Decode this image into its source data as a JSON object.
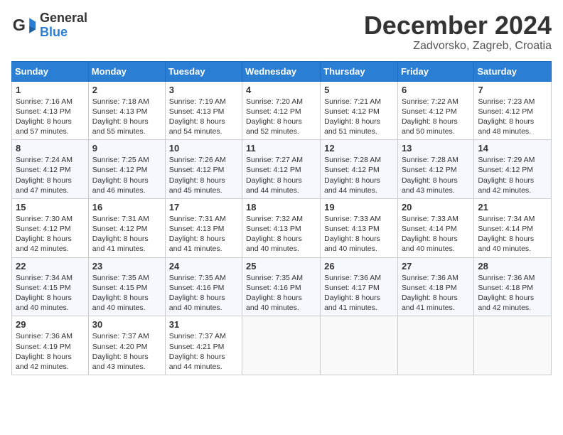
{
  "logo": {
    "general": "General",
    "blue": "Blue"
  },
  "title": "December 2024",
  "location": "Zadvorsko, Zagreb, Croatia",
  "columns": [
    "Sunday",
    "Monday",
    "Tuesday",
    "Wednesday",
    "Thursday",
    "Friday",
    "Saturday"
  ],
  "weeks": [
    [
      {
        "day": "1",
        "sunrise": "7:16 AM",
        "sunset": "4:13 PM",
        "daylight": "8 hours and 57 minutes."
      },
      {
        "day": "2",
        "sunrise": "7:18 AM",
        "sunset": "4:13 PM",
        "daylight": "8 hours and 55 minutes."
      },
      {
        "day": "3",
        "sunrise": "7:19 AM",
        "sunset": "4:13 PM",
        "daylight": "8 hours and 54 minutes."
      },
      {
        "day": "4",
        "sunrise": "7:20 AM",
        "sunset": "4:12 PM",
        "daylight": "8 hours and 52 minutes."
      },
      {
        "day": "5",
        "sunrise": "7:21 AM",
        "sunset": "4:12 PM",
        "daylight": "8 hours and 51 minutes."
      },
      {
        "day": "6",
        "sunrise": "7:22 AM",
        "sunset": "4:12 PM",
        "daylight": "8 hours and 50 minutes."
      },
      {
        "day": "7",
        "sunrise": "7:23 AM",
        "sunset": "4:12 PM",
        "daylight": "8 hours and 48 minutes."
      }
    ],
    [
      {
        "day": "8",
        "sunrise": "7:24 AM",
        "sunset": "4:12 PM",
        "daylight": "8 hours and 47 minutes."
      },
      {
        "day": "9",
        "sunrise": "7:25 AM",
        "sunset": "4:12 PM",
        "daylight": "8 hours and 46 minutes."
      },
      {
        "day": "10",
        "sunrise": "7:26 AM",
        "sunset": "4:12 PM",
        "daylight": "8 hours and 45 minutes."
      },
      {
        "day": "11",
        "sunrise": "7:27 AM",
        "sunset": "4:12 PM",
        "daylight": "8 hours and 44 minutes."
      },
      {
        "day": "12",
        "sunrise": "7:28 AM",
        "sunset": "4:12 PM",
        "daylight": "8 hours and 44 minutes."
      },
      {
        "day": "13",
        "sunrise": "7:28 AM",
        "sunset": "4:12 PM",
        "daylight": "8 hours and 43 minutes."
      },
      {
        "day": "14",
        "sunrise": "7:29 AM",
        "sunset": "4:12 PM",
        "daylight": "8 hours and 42 minutes."
      }
    ],
    [
      {
        "day": "15",
        "sunrise": "7:30 AM",
        "sunset": "4:12 PM",
        "daylight": "8 hours and 42 minutes."
      },
      {
        "day": "16",
        "sunrise": "7:31 AM",
        "sunset": "4:12 PM",
        "daylight": "8 hours and 41 minutes."
      },
      {
        "day": "17",
        "sunrise": "7:31 AM",
        "sunset": "4:13 PM",
        "daylight": "8 hours and 41 minutes."
      },
      {
        "day": "18",
        "sunrise": "7:32 AM",
        "sunset": "4:13 PM",
        "daylight": "8 hours and 40 minutes."
      },
      {
        "day": "19",
        "sunrise": "7:33 AM",
        "sunset": "4:13 PM",
        "daylight": "8 hours and 40 minutes."
      },
      {
        "day": "20",
        "sunrise": "7:33 AM",
        "sunset": "4:14 PM",
        "daylight": "8 hours and 40 minutes."
      },
      {
        "day": "21",
        "sunrise": "7:34 AM",
        "sunset": "4:14 PM",
        "daylight": "8 hours and 40 minutes."
      }
    ],
    [
      {
        "day": "22",
        "sunrise": "7:34 AM",
        "sunset": "4:15 PM",
        "daylight": "8 hours and 40 minutes."
      },
      {
        "day": "23",
        "sunrise": "7:35 AM",
        "sunset": "4:15 PM",
        "daylight": "8 hours and 40 minutes."
      },
      {
        "day": "24",
        "sunrise": "7:35 AM",
        "sunset": "4:16 PM",
        "daylight": "8 hours and 40 minutes."
      },
      {
        "day": "25",
        "sunrise": "7:35 AM",
        "sunset": "4:16 PM",
        "daylight": "8 hours and 40 minutes."
      },
      {
        "day": "26",
        "sunrise": "7:36 AM",
        "sunset": "4:17 PM",
        "daylight": "8 hours and 41 minutes."
      },
      {
        "day": "27",
        "sunrise": "7:36 AM",
        "sunset": "4:18 PM",
        "daylight": "8 hours and 41 minutes."
      },
      {
        "day": "28",
        "sunrise": "7:36 AM",
        "sunset": "4:18 PM",
        "daylight": "8 hours and 42 minutes."
      }
    ],
    [
      {
        "day": "29",
        "sunrise": "7:36 AM",
        "sunset": "4:19 PM",
        "daylight": "8 hours and 42 minutes."
      },
      {
        "day": "30",
        "sunrise": "7:37 AM",
        "sunset": "4:20 PM",
        "daylight": "8 hours and 43 minutes."
      },
      {
        "day": "31",
        "sunrise": "7:37 AM",
        "sunset": "4:21 PM",
        "daylight": "8 hours and 44 minutes."
      },
      null,
      null,
      null,
      null
    ]
  ]
}
